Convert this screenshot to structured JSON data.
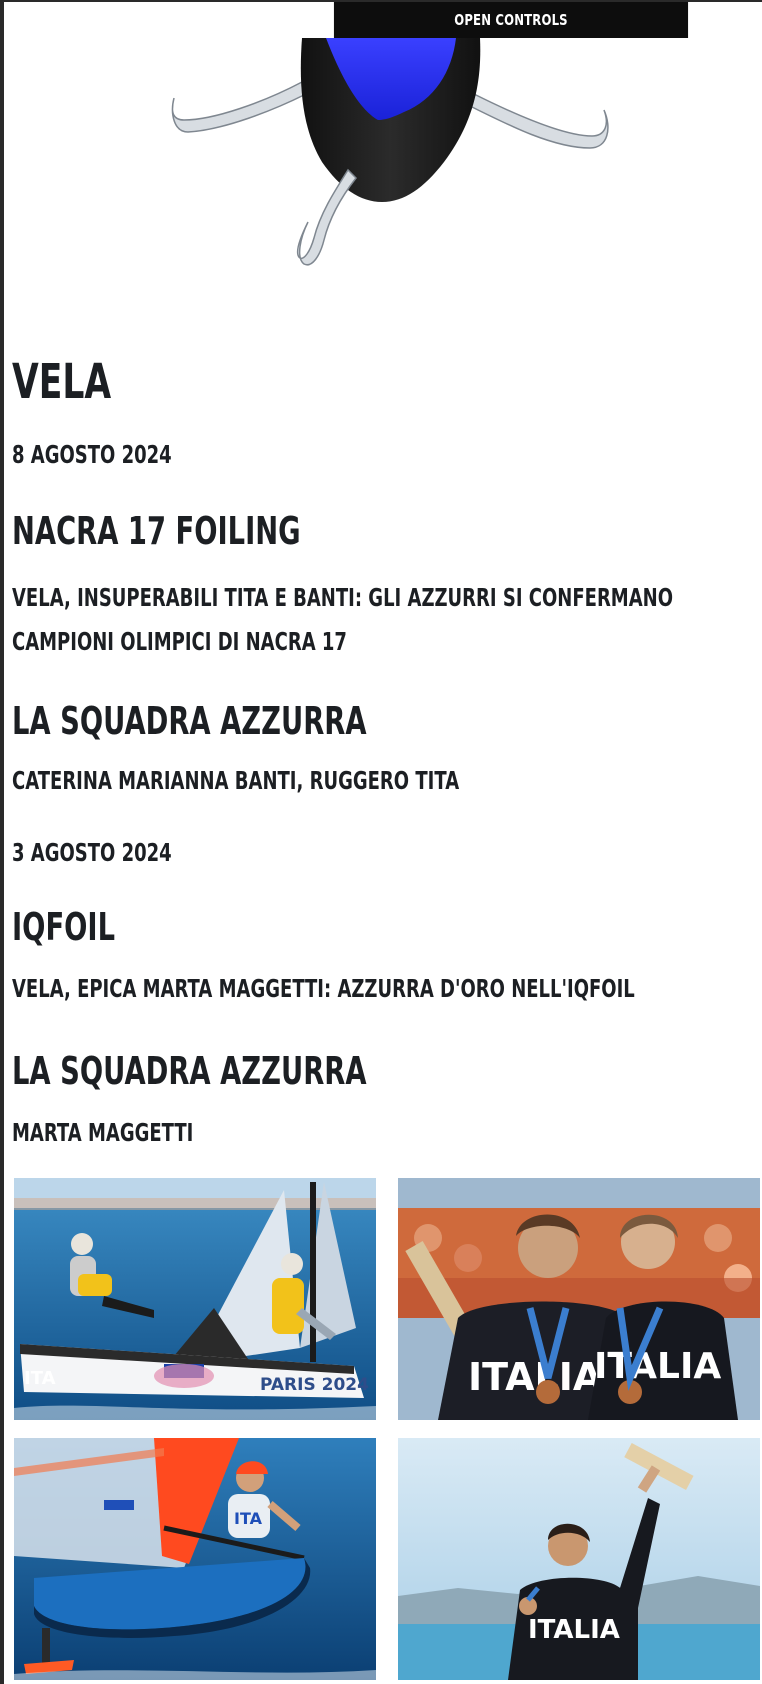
{
  "top_bar": {
    "label": "OPEN CONTROLS"
  },
  "sport": {
    "title": "VELA"
  },
  "entries": [
    {
      "date": "8 AGOSTO 2024",
      "discipline": "NACRA 17 FOILING",
      "headline": "VELA, INSUPERABILI TITA E BANTI: GLI AZZURRI SI CONFERMANO CAMPIONI OLIMPICI DI NACRA 17",
      "team_heading": "LA SQUADRA AZZURRA",
      "athletes": "CATERINA MARIANNA BANTI, RUGGERO TITA"
    },
    {
      "date": "3 AGOSTO 2024",
      "discipline": "IQFOIL",
      "headline": "VELA, EPICA MARTA MAGGETTI: AZZURRA D'ORO NELL'IQFOIL",
      "team_heading": "LA SQUADRA AZZURRA",
      "athletes": "MARTA MAGGETTI"
    }
  ],
  "photos": [
    {
      "name": "nacra-17-race-photo",
      "caption_hull_text": "ITA",
      "hull_text": "PARIS 2024"
    },
    {
      "name": "tita-banti-medal-photo",
      "jersey_text": "ITALIA"
    },
    {
      "name": "iqfoil-race-photo",
      "sail_text": "ITA"
    },
    {
      "name": "maggetti-celebration-photo",
      "jersey_text": "ITALIA"
    }
  ],
  "colors": {
    "text": "#1c1f23",
    "bar": "#0d0d0d",
    "sea": "#1d6ea8",
    "accent_blue": "#1f2ee8"
  }
}
